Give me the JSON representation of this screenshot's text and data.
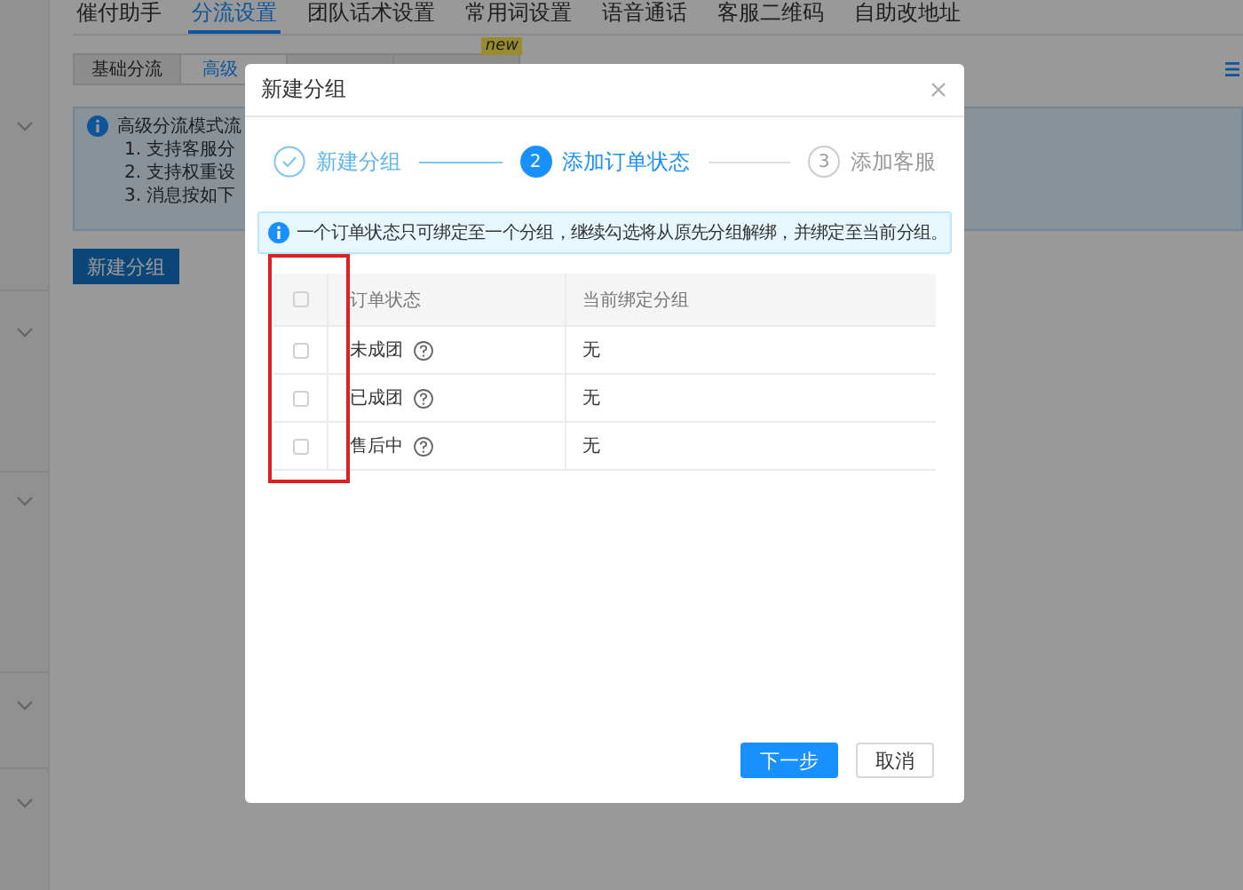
{
  "nav_tabs": [
    {
      "label": "催付助手",
      "selected": false
    },
    {
      "label": "分流设置",
      "selected": true
    },
    {
      "label": "团队话术设置",
      "selected": false
    },
    {
      "label": "常用词设置",
      "selected": false
    },
    {
      "label": "语音通话",
      "selected": false
    },
    {
      "label": "客服二维码",
      "selected": false
    },
    {
      "label": "自助改地址",
      "selected": false
    }
  ],
  "sub_tabs": [
    {
      "label": "基础分流",
      "selected": false
    },
    {
      "label": "高级",
      "selected": true
    },
    {
      "selected": false
    },
    {
      "selected": false,
      "badge": "new"
    }
  ],
  "info_box": {
    "lines": [
      "高级分流模式流",
      "1. 支持客服分",
      "2. 支持权重设",
      "3. 消息按如下"
    ]
  },
  "new_group_button": "新建分组",
  "dialog": {
    "title": "新建分组",
    "steps": [
      {
        "label": "新建分组",
        "kind": "done"
      },
      {
        "number": "2",
        "label": "添加订单状态",
        "kind": "active"
      },
      {
        "number": "3",
        "label": "添加客服",
        "kind": "pending"
      }
    ],
    "notice": "一个订单状态只可绑定至一个分组，继续勾选将从原先分组解绑，并绑定至当前分组。",
    "table": {
      "header_checked": false,
      "columns": [
        "订单状态",
        "当前绑定分组"
      ],
      "rows": [
        {
          "checked": false,
          "status": "未成团",
          "group": "无"
        },
        {
          "checked": false,
          "status": "已成团",
          "group": "无"
        },
        {
          "checked": false,
          "status": "售后中",
          "group": "无"
        }
      ]
    },
    "buttons": [
      {
        "label": "下一步",
        "kind": "primary"
      },
      {
        "label": "取消",
        "kind": "default"
      }
    ]
  }
}
